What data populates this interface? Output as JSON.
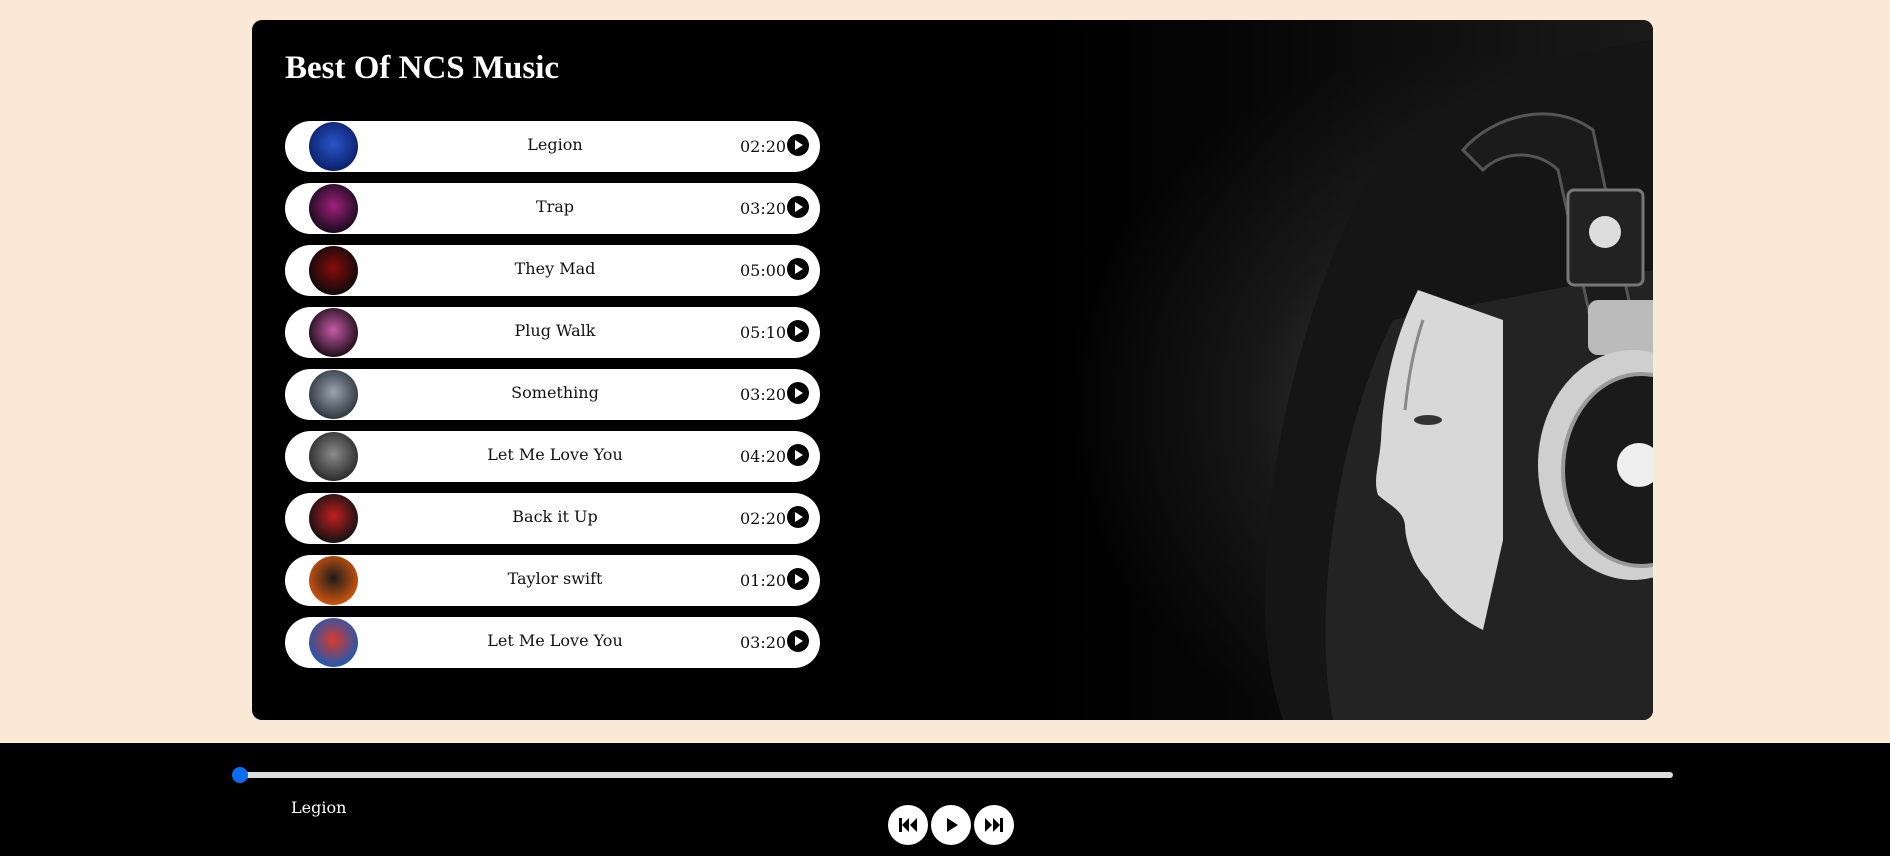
{
  "title": "Best Of NCS Music",
  "songs": [
    {
      "name": "Legion",
      "duration": "02:20",
      "cover": [
        "#0b1f6a",
        "#2a56c8"
      ]
    },
    {
      "name": "Trap",
      "duration": "03:20",
      "cover": [
        "#160a1e",
        "#a0207a"
      ]
    },
    {
      "name": "They Mad",
      "duration": "05:00",
      "cover": [
        "#0a0a0a",
        "#8a0c0c"
      ]
    },
    {
      "name": "Plug Walk",
      "duration": "05:10",
      "cover": [
        "#1a0d16",
        "#c65aa8"
      ]
    },
    {
      "name": "Something",
      "duration": "03:20",
      "cover": [
        "#2c3440",
        "#9aa4ae"
      ]
    },
    {
      "name": "Let Me Love You",
      "duration": "04:20",
      "cover": [
        "#2a2a2a",
        "#8b8b8b"
      ]
    },
    {
      "name": "Back it Up",
      "duration": "02:20",
      "cover": [
        "#111111",
        "#c22020"
      ]
    },
    {
      "name": "Taylor swift",
      "duration": "01:20",
      "cover": [
        "#d2560e",
        "#1c1c1c"
      ]
    },
    {
      "name": "Let Me Love You",
      "duration": "03:20",
      "cover": [
        "#1d58b5",
        "#d83a2a"
      ]
    }
  ],
  "player": {
    "current_song": "Legion",
    "progress": 0,
    "accent": "#0a6ef0",
    "controls": [
      "previous-icon",
      "play-icon",
      "next-icon"
    ]
  }
}
